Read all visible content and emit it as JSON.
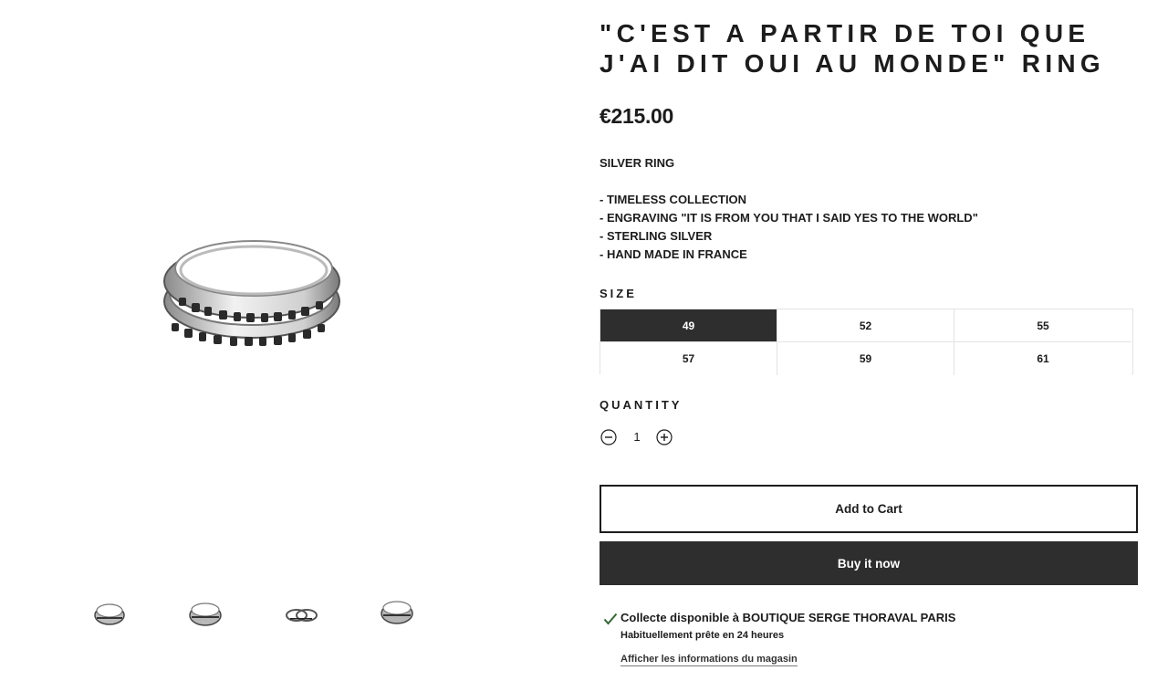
{
  "product": {
    "title": "\"C'EST A PARTIR DE TOI QUE J'AI DIT OUI AU MONDE\" RING",
    "price": "€215.00",
    "description": {
      "heading": "SILVER RING",
      "bullets": [
        "- TIMELESS COLLECTION",
        "- ENGRAVING \"IT IS FROM YOU THAT I SAID YES TO THE WORLD\"",
        "- STERLING SILVER",
        "- HAND MADE IN FRANCE"
      ]
    }
  },
  "gallery": {
    "main_image_icon": "engraved-silver-ring-image",
    "thumbnails": [
      {
        "icon": "ring-thumbnail-icon"
      },
      {
        "icon": "ring-thumbnail-icon"
      },
      {
        "icon": "double-ring-thumbnail-icon"
      },
      {
        "icon": "ring-thumbnail-icon"
      }
    ]
  },
  "size": {
    "label": "SIZE",
    "options": [
      "49",
      "52",
      "55",
      "57",
      "59",
      "61"
    ],
    "selected": "49"
  },
  "quantity": {
    "label": "QUANTITY",
    "value": "1",
    "minus_icon": "minus-circle-icon",
    "plus_icon": "plus-circle-icon"
  },
  "actions": {
    "add_to_cart": "Add to Cart",
    "buy_now": "Buy it now"
  },
  "pickup": {
    "icon": "checkmark-icon",
    "title": "Collecte disponible à BOUTIQUE SERGE THORAVAL PARIS",
    "subtitle": "Habituellement prête en 24 heures",
    "link": "Afficher les informations du magasin"
  },
  "colors": {
    "text": "#1c1c1c",
    "selected_bg": "#2e2e2e",
    "border": "#e3e3e3",
    "check_green": "#2d6a2d"
  }
}
